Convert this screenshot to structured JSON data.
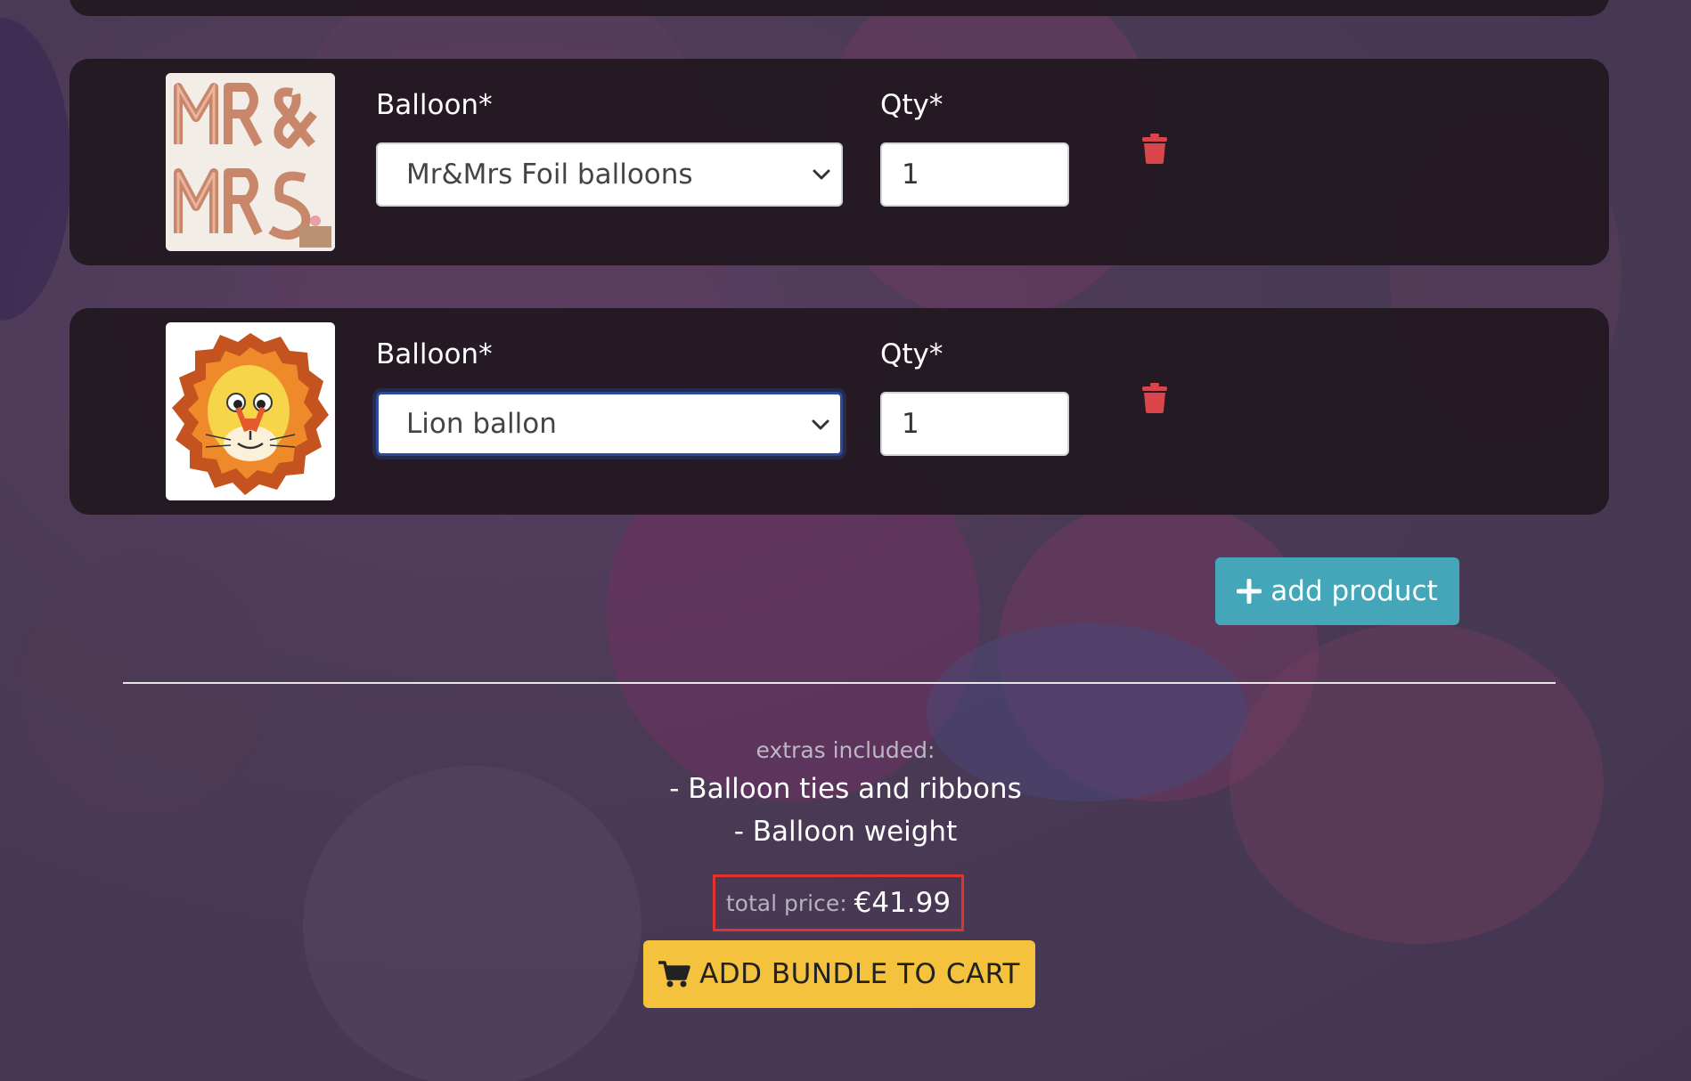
{
  "rows": [
    {
      "image_alt": "Mr & Mrs foil balloons",
      "balloon_label": "Balloon*",
      "balloon_value": "Mr&Mrs Foil balloons",
      "qty_label": "Qty*",
      "qty_value": "1"
    },
    {
      "image_alt": "Lion balloon",
      "balloon_label": "Balloon*",
      "balloon_value": "Lion ballon",
      "qty_label": "Qty*",
      "qty_value": "1"
    }
  ],
  "add_product_label": "add product",
  "extras": {
    "title": "extras included:",
    "items": [
      "- Balloon ties and ribbons",
      "- Balloon weight"
    ]
  },
  "price": {
    "label": "total price:",
    "value": "€41.99"
  },
  "cart_button_label": "ADD BUNDLE TO CART",
  "colors": {
    "card_bg": "#211820",
    "add_button": "#44a6b8",
    "cart_button": "#f5c23e",
    "trash": "#d9454a",
    "price_highlight": "#e0332f"
  },
  "icons": [
    "trash-icon",
    "plus-icon",
    "cart-icon",
    "chevron-down-icon"
  ]
}
